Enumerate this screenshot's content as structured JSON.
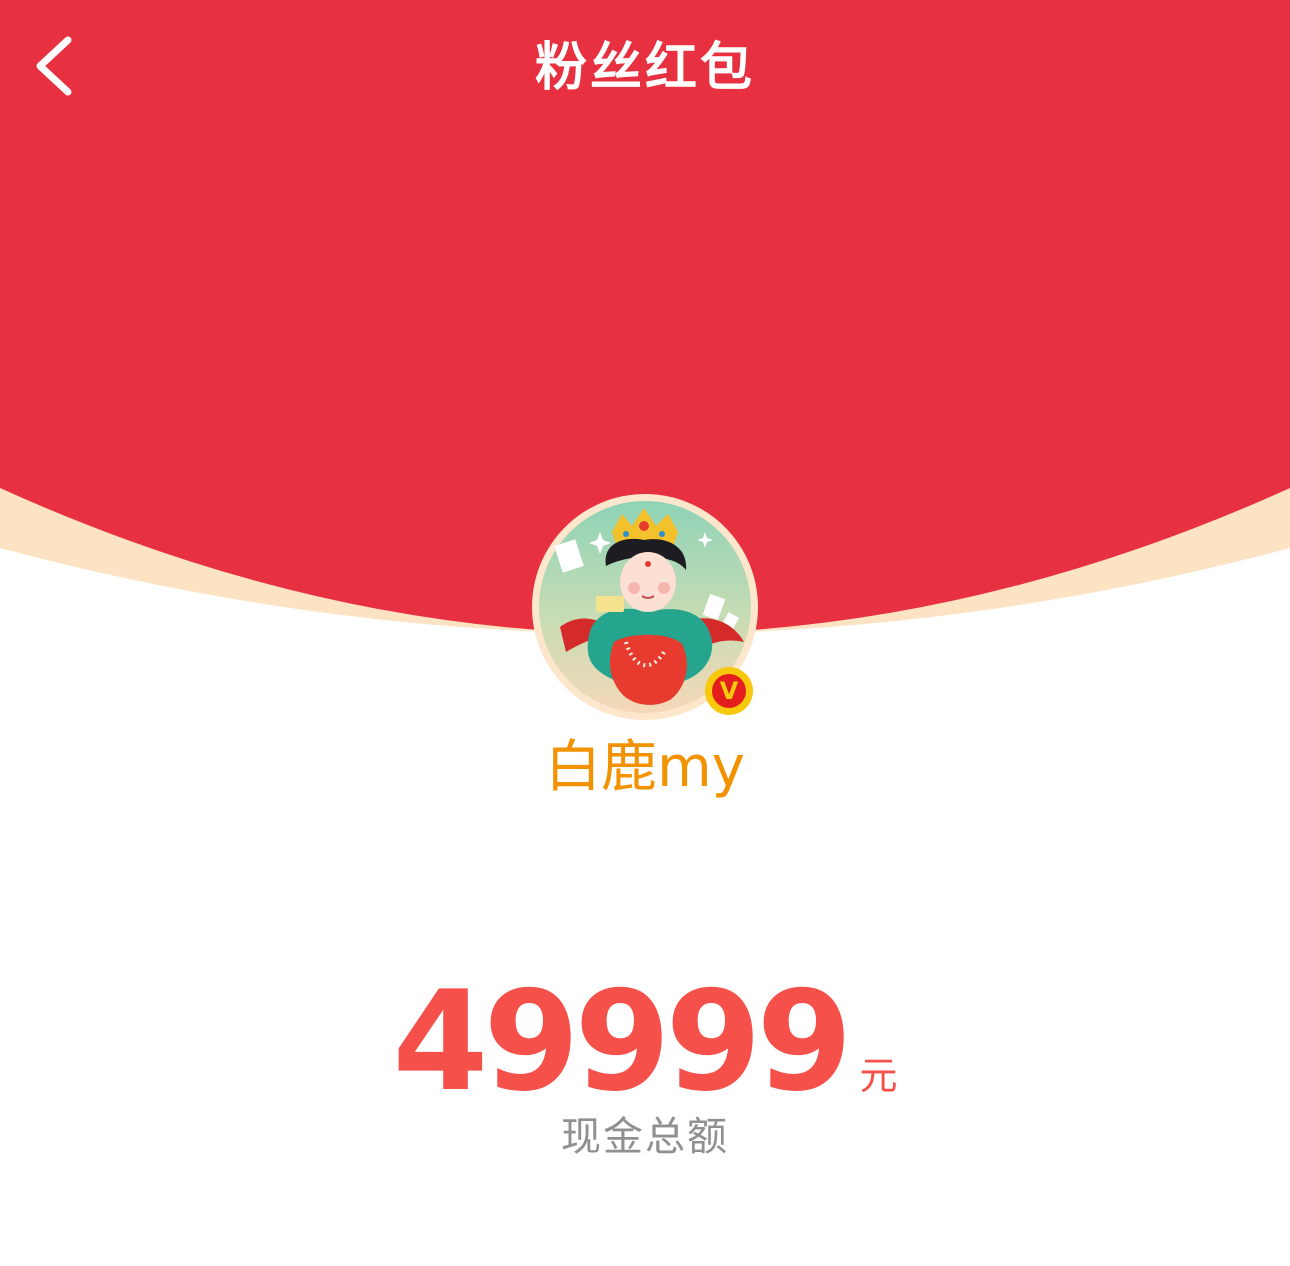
{
  "header": {
    "title": "粉丝红包",
    "back_icon": "chevron-left-icon"
  },
  "profile": {
    "username": "白鹿my",
    "avatar_icon": "avatar-illustration",
    "verified_badge": "V",
    "verified_icon": "verified-badge-icon"
  },
  "amount": {
    "value": "49999",
    "unit": "元",
    "label": "现金总额"
  },
  "colors": {
    "primary_red": "#e83140",
    "cream_rim": "#fbe3c3",
    "username": "#f39200",
    "amount": "#f5504a",
    "label_gray": "#909090",
    "badge_gold": "#f8c80c",
    "badge_red": "#e41e1e"
  }
}
